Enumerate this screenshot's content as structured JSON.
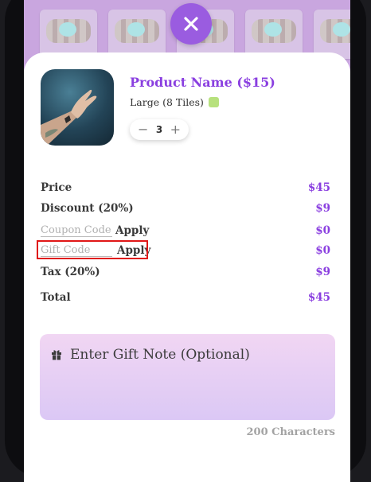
{
  "product": {
    "name": "Product Name ($15)",
    "variant": "Large (8 Tiles)",
    "quantity": "3",
    "decrement": "−",
    "increment": "+",
    "accent_color": "#8a3fe0",
    "swatch_color": "#b7e17d"
  },
  "summary": {
    "price_label": "Price",
    "price_value": "$45",
    "discount_label": "Discount (20%)",
    "discount_value": "$9",
    "coupon_placeholder": "Coupon Code",
    "coupon_apply": "Apply",
    "coupon_value": "$0",
    "gift_placeholder": "Gift Code",
    "gift_apply": "Apply",
    "gift_value": "$0",
    "tax_label": "Tax (20%)",
    "tax_value": "$9",
    "total_label": "Total",
    "total_value": "$45"
  },
  "gift_note": {
    "placeholder": "Enter Gift Note (Optional)",
    "char_count": "200 Characters"
  },
  "icons": {
    "close": "close-icon",
    "gift": "gift-icon"
  }
}
